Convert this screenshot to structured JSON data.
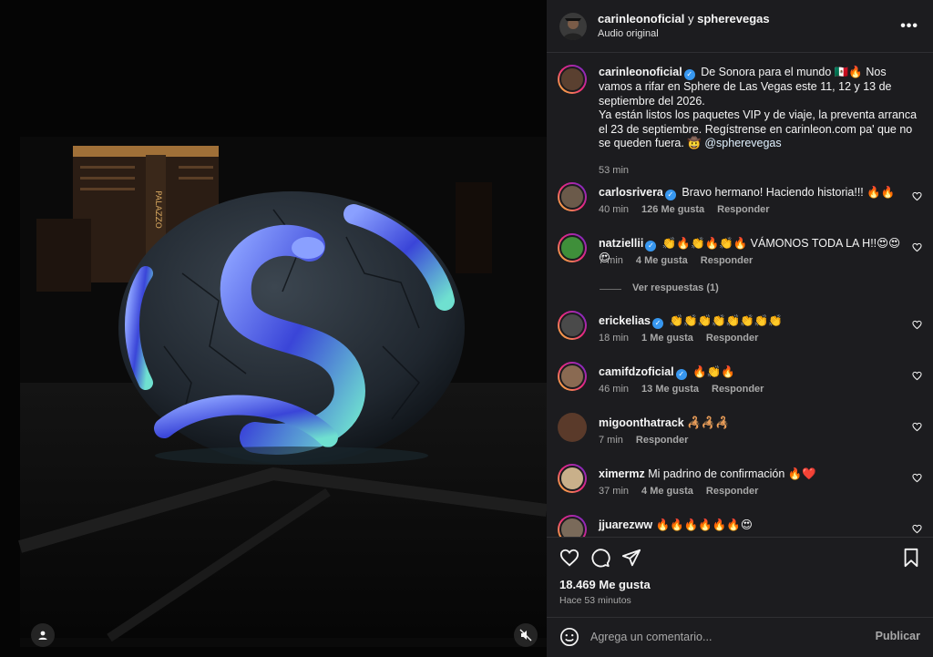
{
  "header": {
    "account1": "carinleonoficial",
    "conjunction": "y",
    "account2": "spherevegas",
    "subtitle": "Audio original",
    "more_label": "•••"
  },
  "caption": {
    "username": "carinleonoficial",
    "text_1": "De Sonora para el mundo 🇲🇽🔥 Nos vamos a rifar en Sphere de Las Vegas este 11, 12 y 13 de septiembre del 2026.",
    "text_2": "Ya están listos los paquetes VIP y de viaje, la preventa arranca el 23 de septiembre. Regístrense en carinleon.com pa' que no se queden fuera. 🤠",
    "mention": "@spherevegas",
    "time": "53 min"
  },
  "comments": [
    {
      "username": "carlosrivera",
      "verified": true,
      "text": "Bravo hermano! Haciendo historia!!! 🔥🔥",
      "time": "40 min",
      "likes": "126 Me gusta",
      "reply": "Responder",
      "avatar_color": "#6b5a4a"
    },
    {
      "username": "natziellii",
      "verified": true,
      "text": "👏🔥👏🔥👏🔥 VÁMONOS TODA LA H!!😍😍😍",
      "time": "7 min",
      "likes": "4 Me gusta",
      "reply": "Responder",
      "avatar_color": "#3f8f3a",
      "view_replies": "Ver respuestas (1)"
    },
    {
      "username": "erickelias",
      "verified": true,
      "text": "👏👏👏👏👏👏👏👏",
      "time": "18 min",
      "likes": "1 Me gusta",
      "reply": "Responder",
      "avatar_color": "#4a4a4a"
    },
    {
      "username": "camifdzoficial",
      "verified": true,
      "text": "🔥👏🔥",
      "time": "46 min",
      "likes": "13 Me gusta",
      "reply": "Responder",
      "avatar_color": "#8a6a52"
    },
    {
      "username": "migoonthatrack",
      "verified": false,
      "text": "🦂🦂🦂",
      "time": "7 min",
      "likes": "",
      "reply": "Responder",
      "avatar_color": "#5a3a2a"
    },
    {
      "username": "ximermz",
      "verified": false,
      "text": "Mi padrino de confirmación 🔥❤️",
      "time": "37 min",
      "likes": "4 Me gusta",
      "reply": "Responder",
      "avatar_color": "#c9b08a"
    },
    {
      "username": "jjuarezww",
      "verified": false,
      "text": "🔥🔥🔥🔥🔥🔥😍",
      "time": "",
      "likes": "",
      "reply": "",
      "avatar_color": "#7a6a5a"
    }
  ],
  "actions": {
    "likes_count": "18.469 Me gusta",
    "posted_ago": "Hace 53 minutos"
  },
  "composer": {
    "placeholder": "Agrega un comentario...",
    "publish_label": "Publicar"
  },
  "scene": {
    "sign_text": "PALAZZO"
  },
  "colors": {
    "panel_bg": "#1c1c1f",
    "verified_blue": "#3797f0",
    "muted_text": "#a8a8a8"
  }
}
